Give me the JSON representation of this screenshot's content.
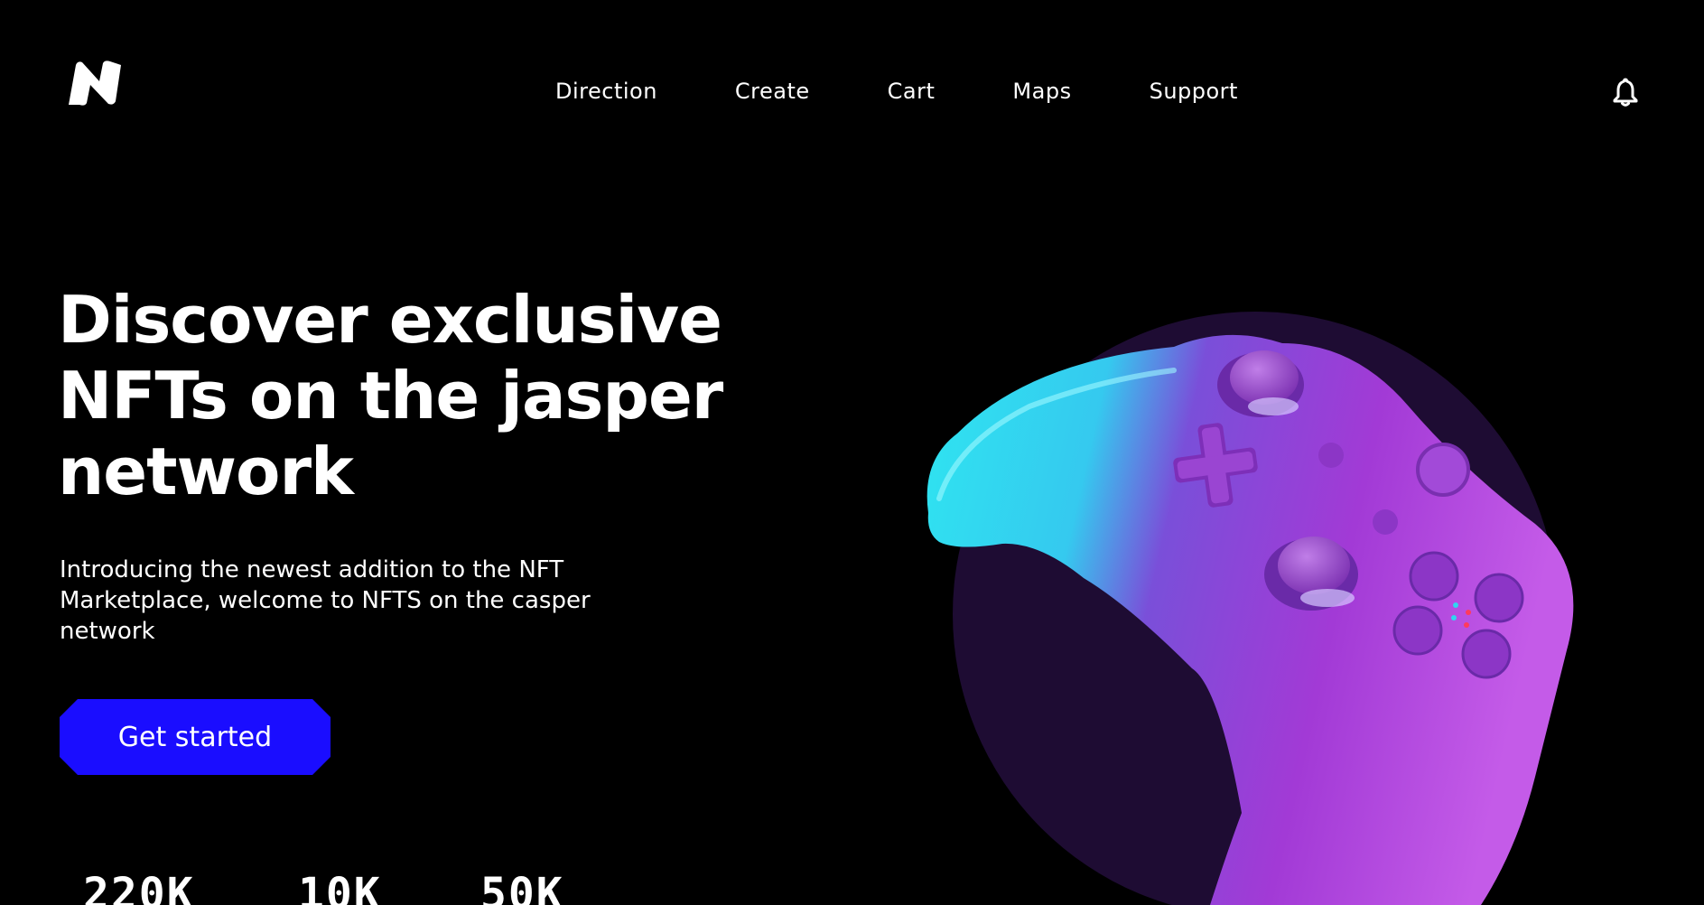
{
  "header": {
    "logo_icon": "n-logo-icon",
    "nav": [
      {
        "label": "Direction"
      },
      {
        "label": "Create"
      },
      {
        "label": "Cart"
      },
      {
        "label": "Maps"
      },
      {
        "label": "Support"
      }
    ],
    "notification_icon": "bell-icon"
  },
  "hero": {
    "title": "Discover exclusive NFTs on the jasper network",
    "subtitle": "Introducing the newest addition to the NFT Marketplace, welcome to NFTS on the casper network",
    "cta_label": "Get started",
    "image_icon": "game-controller-image"
  },
  "stats": [
    {
      "value": "220K"
    },
    {
      "value": "10K"
    },
    {
      "value": "50K"
    }
  ],
  "colors": {
    "background": "#000000",
    "text": "#ffffff",
    "cta": "#1a0dff",
    "circle": "#1e0c33",
    "controller_cyan": "#2fe6f0",
    "controller_purple": "#a23ad6"
  }
}
